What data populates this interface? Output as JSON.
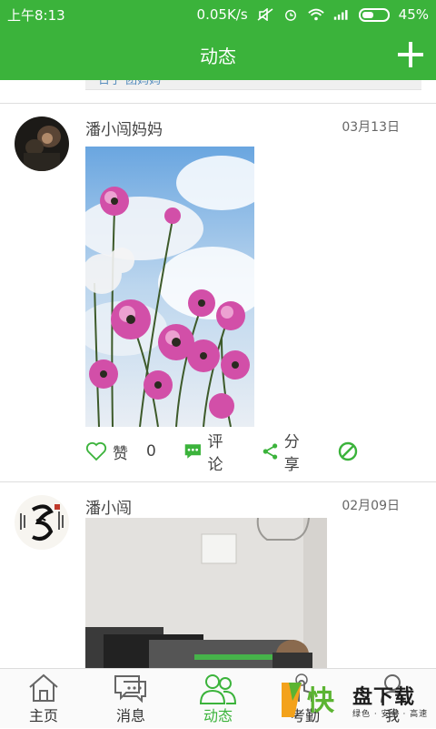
{
  "status_bar": {
    "time": "上午8:13",
    "network_speed": "0.05K/s",
    "battery": "45%"
  },
  "nav": {
    "title": "动态"
  },
  "previous_post": {
    "quote_fragment": "日子 团妈妈"
  },
  "posts": [
    {
      "author": "潘小闯妈妈",
      "date": "03月13日",
      "actions": {
        "like_label": "赞",
        "like_count": "0",
        "comment_label": "评论",
        "share_label": "分享"
      }
    },
    {
      "author": "潘小闯",
      "date": "02月09日"
    }
  ],
  "tabs": [
    {
      "label": "主页",
      "icon": "home-icon"
    },
    {
      "label": "消息",
      "icon": "message-icon"
    },
    {
      "label": "动态",
      "icon": "moments-icon",
      "active": true
    },
    {
      "label": "考勤",
      "icon": "attendance-icon"
    },
    {
      "label": "我",
      "icon": "profile-icon"
    }
  ],
  "watermark": {
    "logo_glyph": "快",
    "main": "盘下载",
    "sub": "绿色 · 安全 · 高速"
  },
  "colors": {
    "brand": "#3bb33b"
  }
}
